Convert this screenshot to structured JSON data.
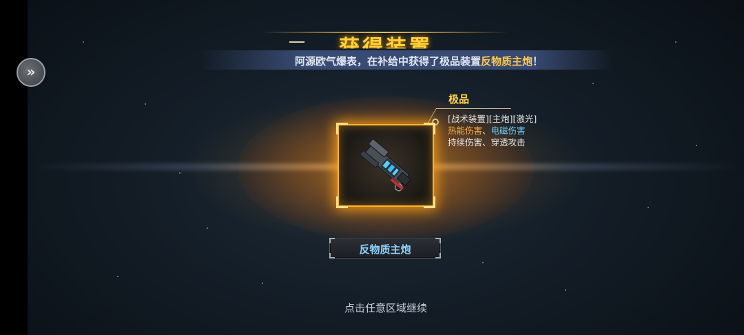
{
  "popup": {
    "title": "获得装置",
    "announcement": {
      "prefix": "阿源欧气爆表，在补给中获得了极品装置",
      "item": "反物质主炮",
      "suffix": "！"
    }
  },
  "item": {
    "grade": "极品",
    "tags": "[战术装置][主炮][激光]",
    "damage_types": [
      "热能伤害",
      "电磁伤害"
    ],
    "separator": "、",
    "effects": "持续伤害、穿透攻击",
    "name": "反物质主炮",
    "icon": "laser-cannon-icon"
  },
  "hint": "点击任意区域继续",
  "colors": {
    "accent_gold": "#ffc94a",
    "frame_orange": "#ffb423",
    "thermal": "#ffb347",
    "electromagnetic": "#6fd5ff",
    "item_name": "#8fd3ff"
  }
}
